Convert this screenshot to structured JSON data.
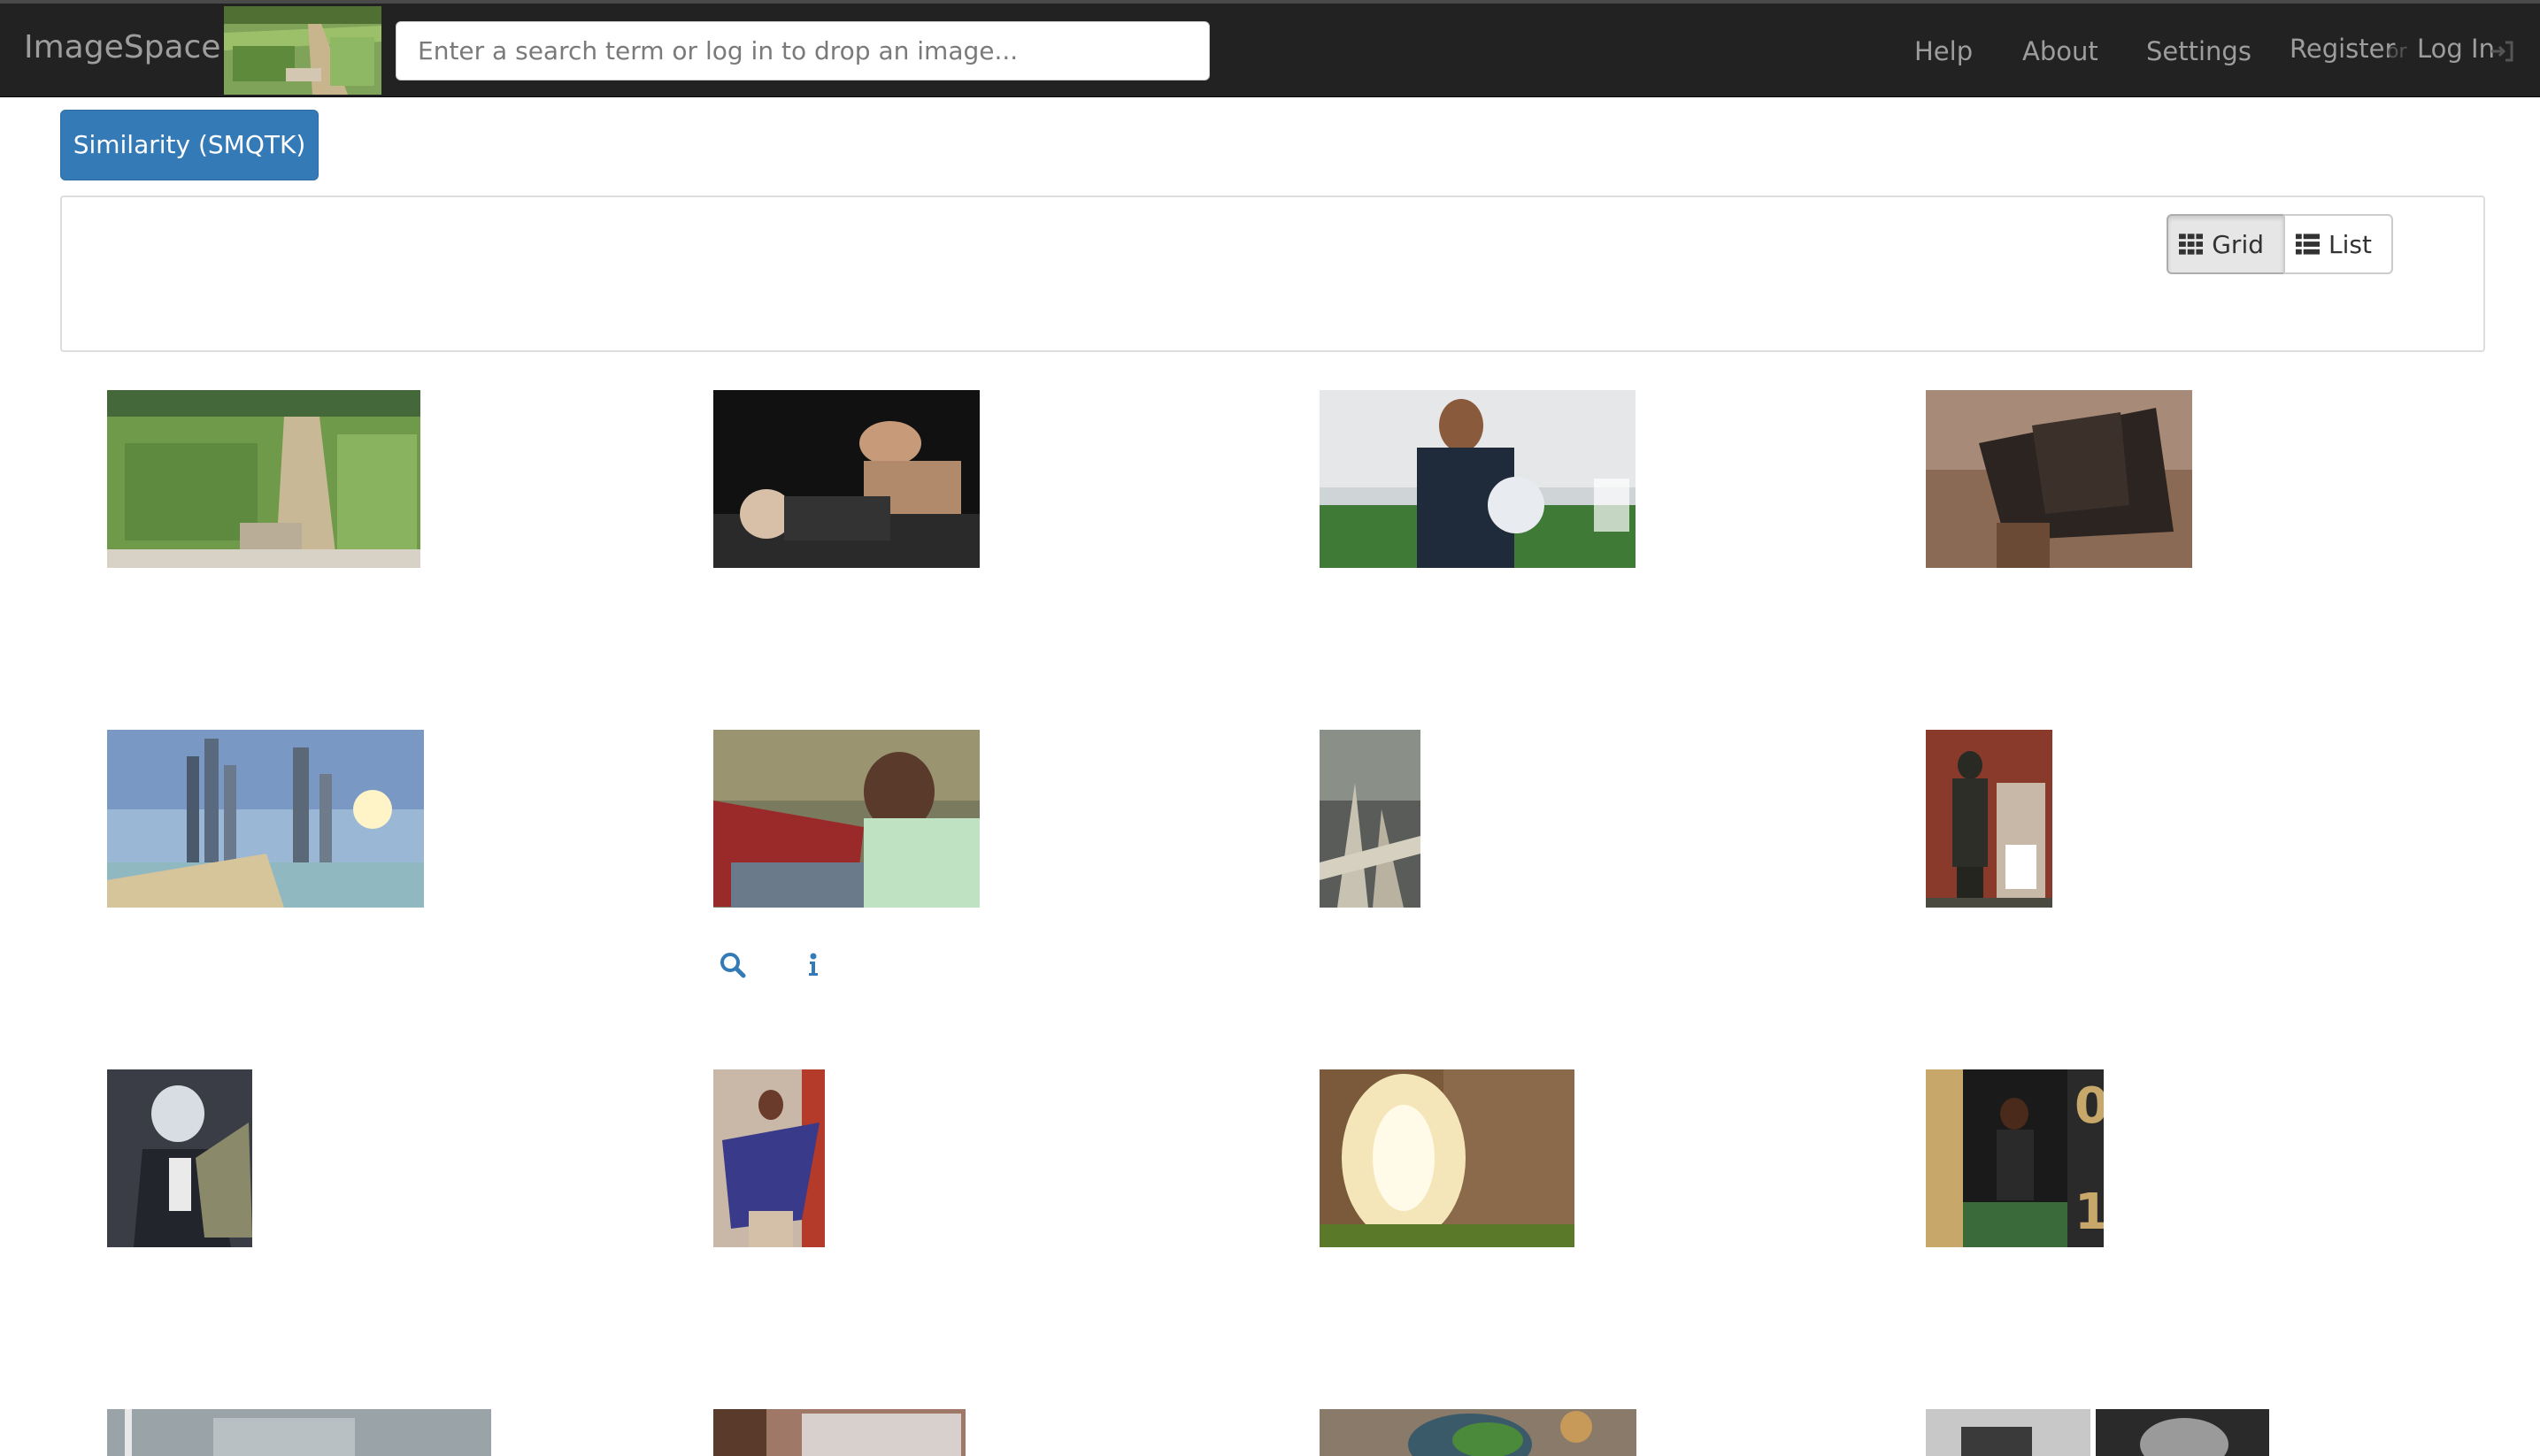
{
  "navbar": {
    "brand": "ImageSpace",
    "search_placeholder": "Enter a search term or log in to drop an image...",
    "links": {
      "help": "Help",
      "about": "About",
      "settings": "Settings",
      "register": "Register",
      "or": "or",
      "login": "Log In"
    }
  },
  "main": {
    "tab_label": "Similarity (SMQTK)",
    "view_toggle": {
      "grid_label": "Grid",
      "list_label": "List",
      "active": "Grid"
    }
  },
  "colors": {
    "navbar_bg": "#222222",
    "nav_text": "#9d9d9d",
    "primary": "#337ab7",
    "icon_blue": "#337ab7"
  },
  "icons": {
    "grid": "th-grid-icon",
    "list": "th-list-icon",
    "login": "log-in-icon",
    "search": "search-icon",
    "info": "info-icon"
  },
  "results": [
    {
      "subject": "aerial-garden-farm"
    },
    {
      "subject": "men-posing-night-rotated"
    },
    {
      "subject": "man-with-football-stadium"
    },
    {
      "subject": "holy-bible-on-stand"
    },
    {
      "subject": "city-skyline-beach-causeway"
    },
    {
      "subject": "boy-on-motorcycle-selfie",
      "actions_shown": [
        "search",
        "info"
      ]
    },
    {
      "subject": "tree-roots-forest"
    },
    {
      "subject": "bronze-statue-emperor"
    },
    {
      "subject": "anime-character-winged"
    },
    {
      "subject": "woman-blue-dress"
    },
    {
      "subject": "glowing-figure-stone-doorway"
    },
    {
      "subject": "full-time-footballer-poster"
    },
    {
      "subject": "partial-thumbnail-1"
    },
    {
      "subject": "partial-thumbnail-2"
    },
    {
      "subject": "partial-thumbnail-food"
    },
    {
      "subject": "partial-thumbnail-kitchen"
    }
  ]
}
